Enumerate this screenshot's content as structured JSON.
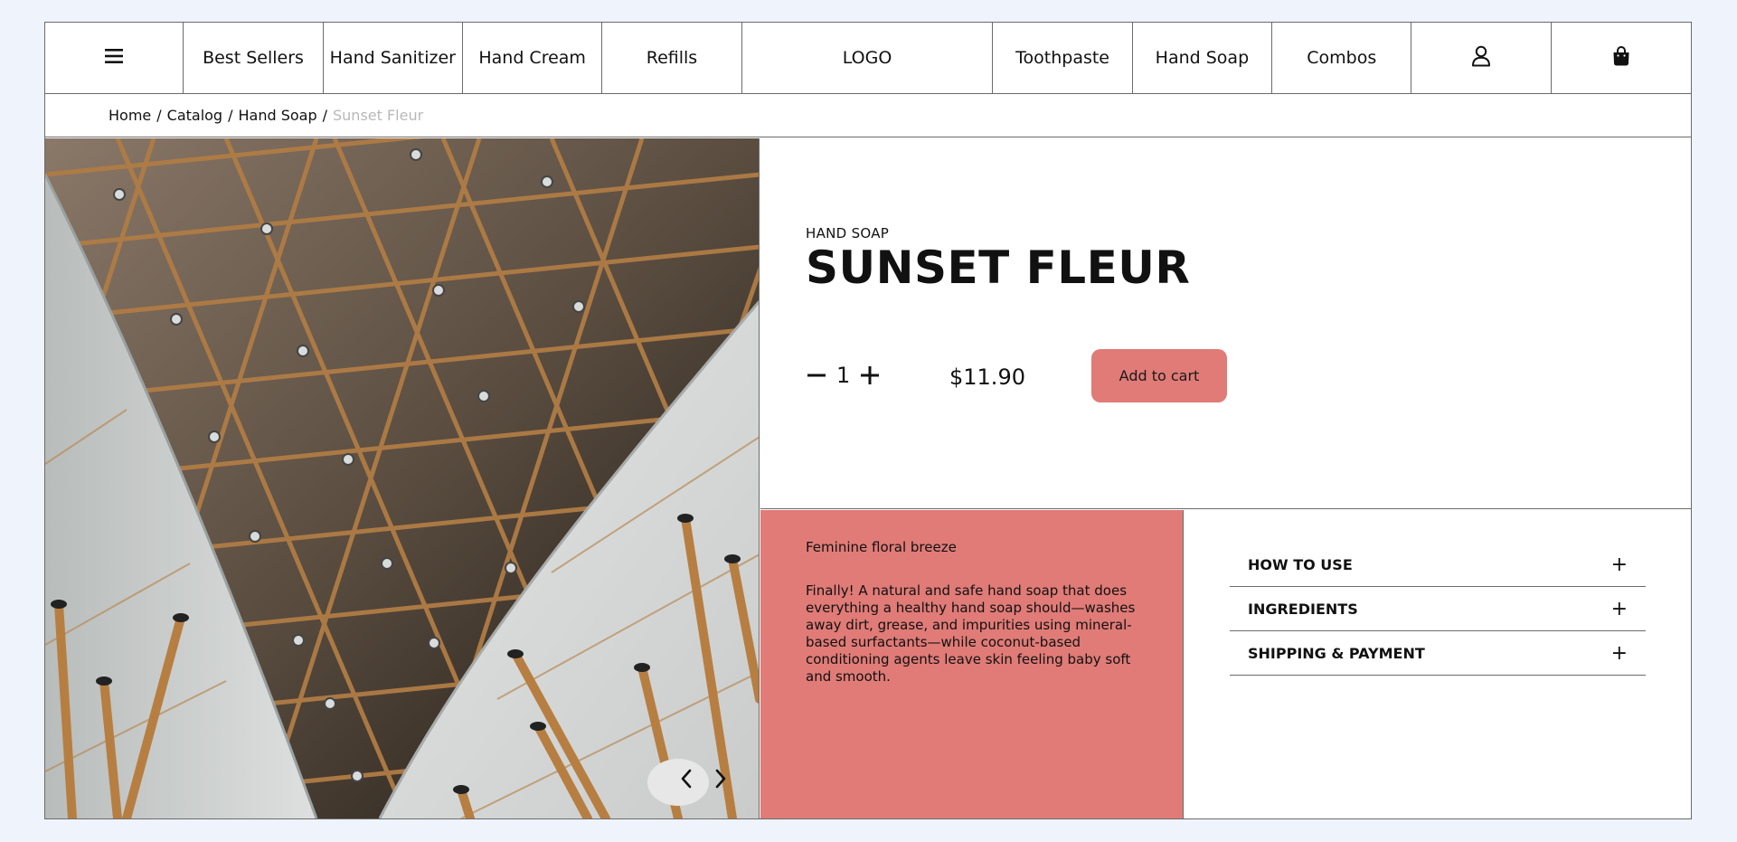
{
  "nav": {
    "menu_icon": "hamburger-menu-icon",
    "left_items": [
      "Best Sellers",
      "Hand Sanitizer",
      "Hand Cream",
      "Refills"
    ],
    "logo": "LOGO",
    "right_items": [
      "Toothpaste",
      "Hand Soap",
      "Combos"
    ],
    "account_icon": "user-icon",
    "cart_icon": "shopping-bag-icon"
  },
  "breadcrumb": {
    "items": [
      "Home",
      "Catalog",
      "Hand Soap"
    ],
    "current": "Sunset Fleur"
  },
  "product": {
    "category": "HAND SOAP",
    "name": "SUNSET FLEUR",
    "quantity": "1",
    "price": "$11.90",
    "add_to_cart": "Add to cart",
    "tagline": "Feminine floral breeze",
    "description": "Finally! A natural and safe hand soap that does everything a healthy hand soap should—washes away dirt, grease, and impurities using mineral-based surfactants—while coconut-based conditioning agents leave skin feeling baby soft and smooth."
  },
  "accordion": [
    {
      "label": "HOW TO USE"
    },
    {
      "label": "INGREDIENTS"
    },
    {
      "label": "SHIPPING & PAYMENT"
    }
  ],
  "colors": {
    "accent": "#e07b77",
    "page_bg": "#eef3fc",
    "border": "#6b6b6b",
    "muted_text": "#b9b9b9"
  }
}
